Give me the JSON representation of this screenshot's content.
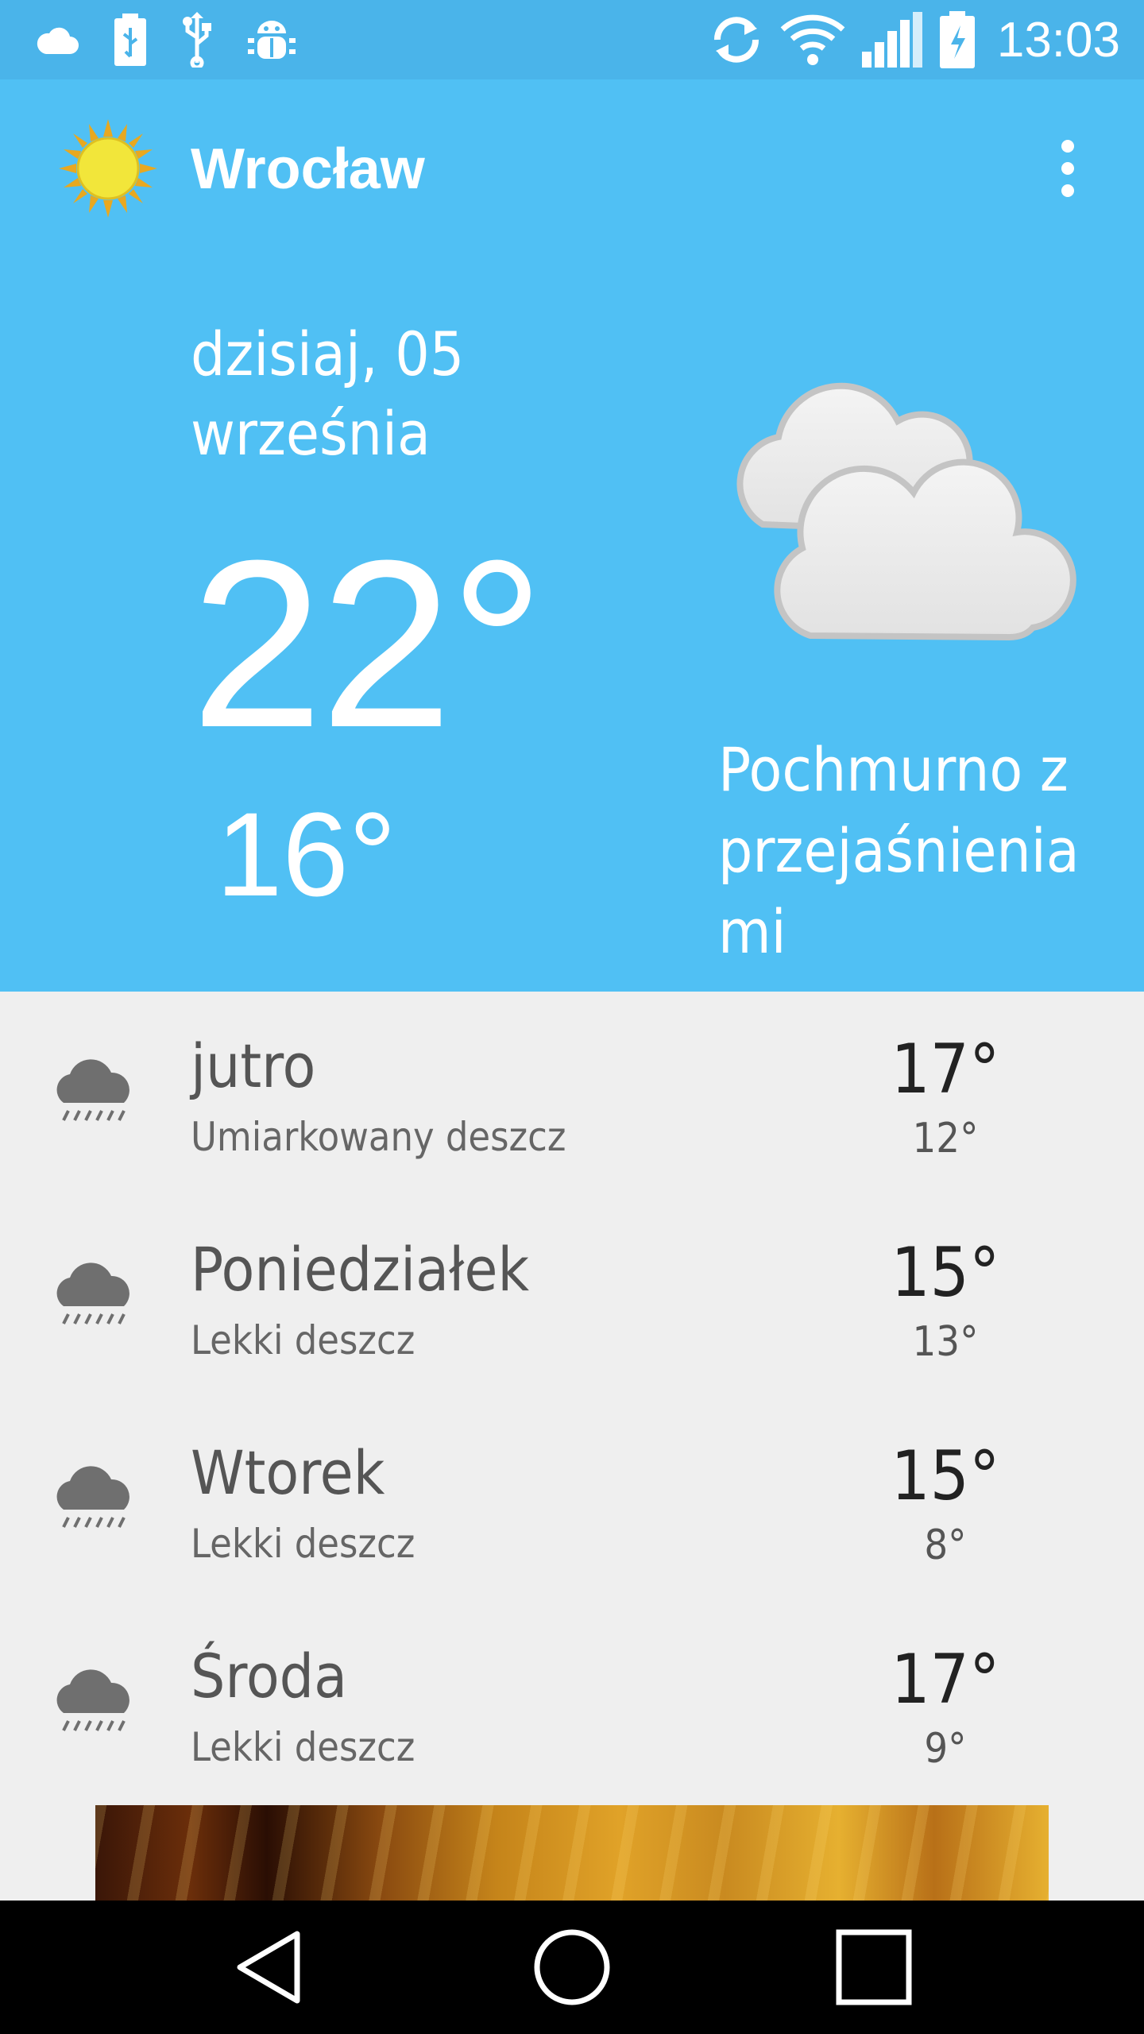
{
  "status_bar": {
    "time": "13:03",
    "left_icons": [
      "cloud-icon",
      "battery-usb-icon",
      "usb-icon",
      "android-debug-icon"
    ],
    "right_icons": [
      "sync-icon",
      "wifi-icon",
      "signal-icon",
      "battery-charging-icon"
    ]
  },
  "header": {
    "city": "Wrocław",
    "app_icon": "sun-icon",
    "menu_icon": "more-vert-icon"
  },
  "today": {
    "date": "dzisiaj, 05 września",
    "high": "22°",
    "low": "16°",
    "condition": "Pochmurno z przejaśnieniami",
    "condition_icon": "partly-cloudy-icon"
  },
  "forecast": [
    {
      "day": "jutro",
      "condition": "Umiarkowany deszcz",
      "high": "17°",
      "low": "12°",
      "icon": "rain-icon"
    },
    {
      "day": "Poniedziałek",
      "condition": "Lekki deszcz",
      "high": "15°",
      "low": "13°",
      "icon": "rain-icon"
    },
    {
      "day": "Wtorek",
      "condition": "Lekki deszcz",
      "high": "15°",
      "low": "8°",
      "icon": "rain-icon"
    },
    {
      "day": "Środa",
      "condition": "Lekki deszcz",
      "high": "17°",
      "low": "9°",
      "icon": "rain-icon"
    }
  ],
  "nav_bar": {
    "icons": [
      "back-icon",
      "home-icon",
      "recents-icon"
    ]
  },
  "colors": {
    "status_bar": "#4ab4ea",
    "header": "#50c0f4",
    "list_background": "#efefef"
  }
}
